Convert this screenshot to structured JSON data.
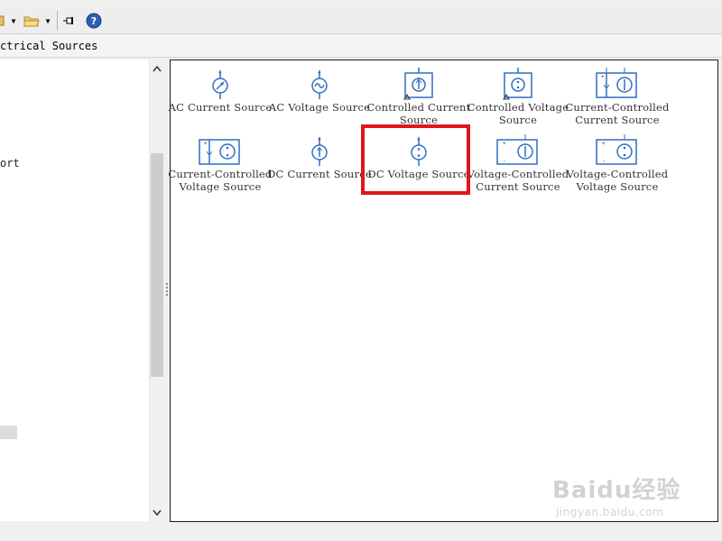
{
  "path_bar": {
    "text": "ctrical Sources"
  },
  "tree": {
    "partial_item": "ort"
  },
  "library": {
    "blocks": [
      {
        "label": "AC Current Source",
        "icon": "ac-current-source-icon"
      },
      {
        "label": "AC Voltage Source",
        "icon": "ac-voltage-source-icon"
      },
      {
        "label": "Controlled Current Source",
        "icon": "controlled-current-source-icon"
      },
      {
        "label": "Controlled Voltage Source",
        "icon": "controlled-voltage-source-icon"
      },
      {
        "label": "Current-Controlled Current Source",
        "icon": "ccc-source-icon"
      },
      {
        "label": "Current-Controlled Voltage Source",
        "icon": "ccv-source-icon"
      },
      {
        "label": "DC Current Source",
        "icon": "dc-current-source-icon"
      },
      {
        "label": "DC Voltage Source",
        "icon": "dc-voltage-source-icon"
      },
      {
        "label": "Voltage-Controlled Current Source",
        "icon": "vcc-source-icon"
      },
      {
        "label": "Voltage-Controlled Voltage Source",
        "icon": "vcv-source-icon"
      }
    ],
    "highlighted": "DC Voltage Source"
  },
  "watermark": {
    "brand": "Baidu经验",
    "url": "jingyan.baidu.com"
  },
  "colors": {
    "icon_blue": "#2f6fc2",
    "highlight_red": "#e3141b",
    "text_gray": "#333333"
  }
}
